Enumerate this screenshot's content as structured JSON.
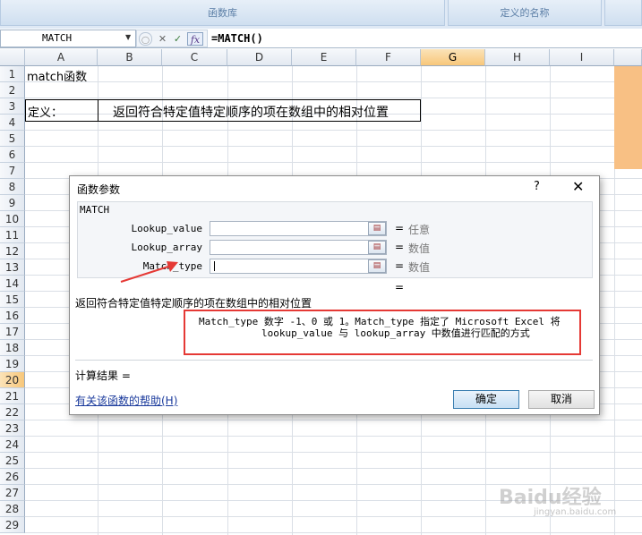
{
  "ribbon": {
    "groups": [
      "函数库",
      "定义的名称",
      ""
    ]
  },
  "formula_bar": {
    "name_box": "MATCH",
    "formula": "=MATCH()",
    "fx_label": "fx"
  },
  "sheet": {
    "columns": [
      "A",
      "B",
      "C",
      "D",
      "E",
      "F",
      "G",
      "H",
      "I"
    ],
    "selected_column": "G",
    "rows": [
      "1",
      "2",
      "3",
      "4",
      "5",
      "6",
      "7",
      "8",
      "9",
      "10",
      "11",
      "12",
      "13",
      "14",
      "15",
      "16",
      "17",
      "18",
      "19",
      "20",
      "21",
      "22",
      "23",
      "24",
      "25",
      "26",
      "27",
      "28",
      "29"
    ],
    "selected_row": "20",
    "cells": {
      "A1": "match函数",
      "A3": "定义：",
      "B3": "返回符合特定值特定顺序的项在数组中的相对位置"
    }
  },
  "dialog": {
    "title": "函数参数",
    "help_glyph": "?",
    "close_glyph": "✕",
    "function_name": "MATCH",
    "args": [
      {
        "name": "Lookup_value",
        "eq": "=",
        "hint": "任意"
      },
      {
        "name": "Lookup_array",
        "eq": "=",
        "hint": "数值"
      },
      {
        "name": "Match_type",
        "eq": "=",
        "hint": "数值"
      }
    ],
    "result_equals": "=",
    "description": "返回符合特定值特定顺序的项在数组中的相对位置",
    "arg_help_line1": "Match_type  数字 -1、0 或 1。Match_type 指定了 Microsoft Excel 将",
    "arg_help_line2": "lookup_value 与 lookup_array 中数值进行匹配的方式",
    "result_label": "计算结果 =",
    "help_link": "有关该函数的帮助(H)",
    "ok_label": "确定",
    "cancel_label": "取消"
  },
  "watermark": {
    "text": "Baidu经验",
    "sub": "jingyan.baidu.com"
  },
  "colors": {
    "red_annotation": "#e53935",
    "selected_header": "#f8c77a",
    "orange_fill": "#f8c084"
  }
}
